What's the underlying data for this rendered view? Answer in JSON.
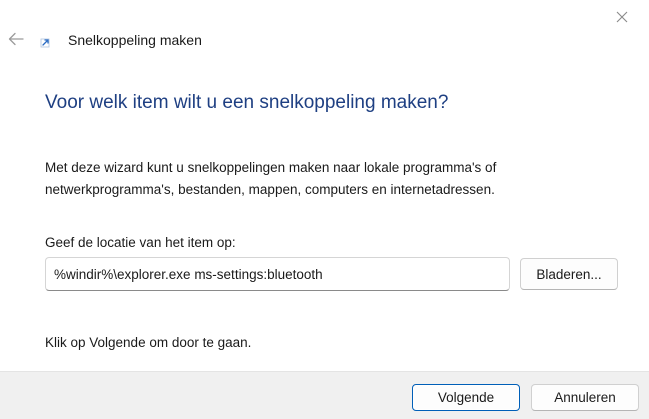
{
  "window": {
    "title": "Snelkoppeling maken",
    "close_icon": "close-icon",
    "back_icon": "back-arrow-icon",
    "title_icon": "shortcut-icon"
  },
  "main": {
    "heading": "Voor welk item wilt u een snelkoppeling maken?",
    "description": "Met deze wizard kunt u snelkoppelingen maken naar lokale programma's of netwerkprogramma's, bestanden, mappen, computers en internetadressen.",
    "location_label": "Geef de locatie van het item op:",
    "location_value": "%windir%\\explorer.exe ms-settings:bluetooth",
    "browse_label": "Bladeren...",
    "hint": "Klik op Volgende om door te gaan."
  },
  "footer": {
    "next_label": "Volgende",
    "cancel_label": "Annuleren"
  },
  "colors": {
    "heading": "#1e3f82",
    "accent": "#005fb8",
    "footer_bg": "#f0f0f0"
  }
}
